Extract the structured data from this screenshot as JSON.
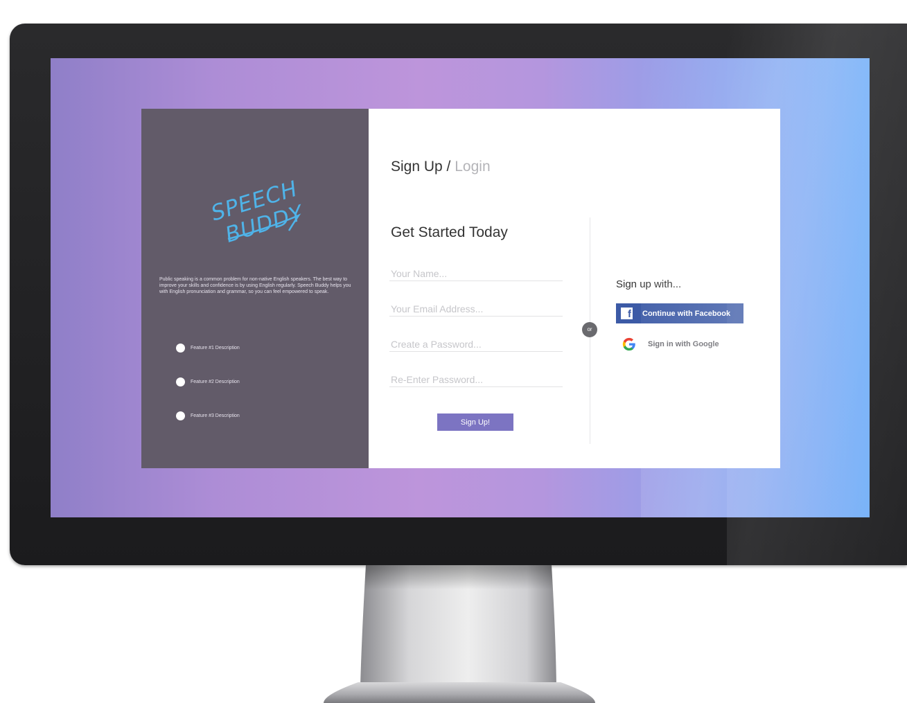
{
  "brand": {
    "logo_line1": "SPEECH",
    "logo_line2": "BUDDY"
  },
  "intro_text": "Public speaking is a common problem for non-native English speakers. The best way to improve your skills and confidence is by using English regularly. Speech Buddy helps you with English pronunciation and grammar, so you can feel empowered to speak.",
  "features": [
    {
      "label": "Feature #1 Description"
    },
    {
      "label": "Feature #2 Description"
    },
    {
      "label": "Feature #3 Description"
    }
  ],
  "tabs": {
    "signup": "Sign Up",
    "separator": " / ",
    "login": "Login"
  },
  "form": {
    "title": "Get Started Today",
    "name_placeholder": "Your Name...",
    "email_placeholder": "Your Email Address...",
    "password_placeholder": "Create a Password...",
    "reenter_placeholder": "Re-Enter Password...",
    "submit_label": "Sign Up!"
  },
  "or_label": "or",
  "social": {
    "title": "Sign up with...",
    "facebook_label": "Continue with Facebook",
    "google_label": "Sign in with Google"
  },
  "colors": {
    "left_panel": "#625b69",
    "accent": "#7c74c2",
    "facebook": "#3c5aa6",
    "logo": "#4fb3e8"
  }
}
